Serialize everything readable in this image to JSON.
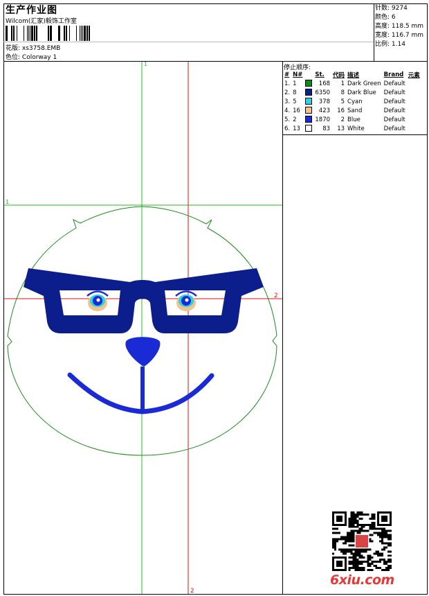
{
  "header": {
    "title": "生产作业图",
    "company": "Wilcom(汇家)毅饰工作室",
    "design_label": "花版:",
    "design_value": "xs3758.EMB",
    "colorway_label": "色位:",
    "colorway_value": "Colorway 1"
  },
  "stats": {
    "stitches": "针数: 9274",
    "colors": "颜色: 6",
    "height": "高度: 118.5 mm",
    "width": "宽度: 116.7 mm",
    "scale": "比例: 1.14"
  },
  "color_sequence": {
    "title": "停止顺序:",
    "headers": [
      "#",
      "N#",
      "",
      "St.",
      "代码",
      "描述",
      "Brand",
      "元素"
    ],
    "rows": [
      {
        "n": "1.",
        "nn": "1",
        "swatch": "#0c8a18",
        "st": "168",
        "code": "1",
        "desc": "Dark Green",
        "brand": "Default"
      },
      {
        "n": "2.",
        "nn": "8",
        "swatch": "#0b1e8c",
        "st": "6350",
        "code": "8",
        "desc": "Dark Blue",
        "brand": "Default"
      },
      {
        "n": "3.",
        "nn": "5",
        "swatch": "#29d3e6",
        "st": "378",
        "code": "5",
        "desc": "Cyan",
        "brand": "Default"
      },
      {
        "n": "4.",
        "nn": "16",
        "swatch": "#f2c38c",
        "st": "423",
        "code": "16",
        "desc": "Sand",
        "brand": "Default"
      },
      {
        "n": "5.",
        "nn": "2",
        "swatch": "#1a2bd6",
        "st": "1870",
        "code": "2",
        "desc": "Blue",
        "brand": "Default"
      },
      {
        "n": "6.",
        "nn": "13",
        "swatch": "#ffffff",
        "st": "83",
        "code": "13",
        "desc": "White",
        "brand": "Default"
      }
    ]
  },
  "guides": {
    "green_label_top": "1",
    "green_label_left": "1",
    "red_label_right": "2",
    "red_label_bottom": "2"
  },
  "watermark": "6xiu.com",
  "colors": {
    "guide_green": "#22c022",
    "guide_red": "#e01010",
    "outline_green": "#1a8a1a",
    "glasses": "#0b1e8c",
    "nose_mouth": "#1a2bd6"
  }
}
